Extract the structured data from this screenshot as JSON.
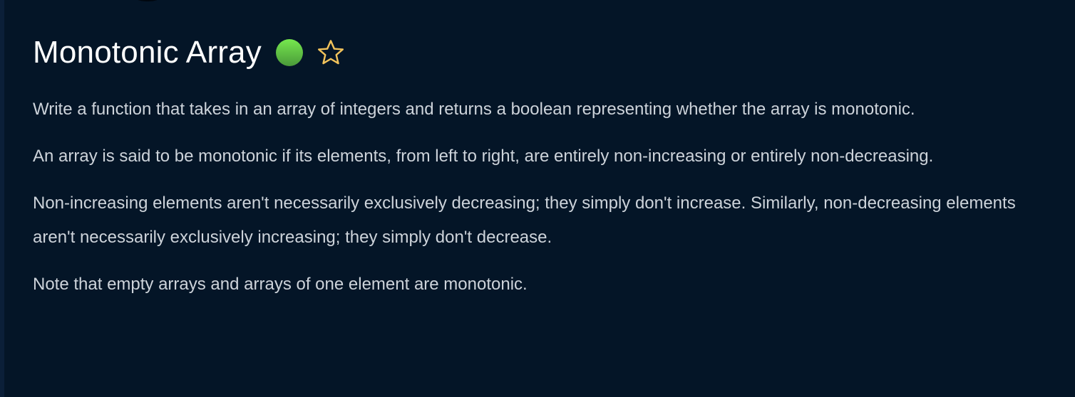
{
  "title": "Monotonic Array",
  "difficulty_color": "#5fc845",
  "favorite_icon": "star-outline-icon",
  "paragraphs": [
    "Write a function that takes in an array of integers and returns a boolean representing whether the array is monotonic.",
    "An array is said to be monotonic if its elements, from left to right, are entirely non-increasing or entirely non-decreasing.",
    "Non-increasing elements aren't necessarily exclusively decreasing; they simply don't increase. Similarly, non-decreasing elements aren't necessarily exclusively increasing; they simply don't decrease.",
    "Note that empty arrays and arrays of one element are monotonic."
  ]
}
